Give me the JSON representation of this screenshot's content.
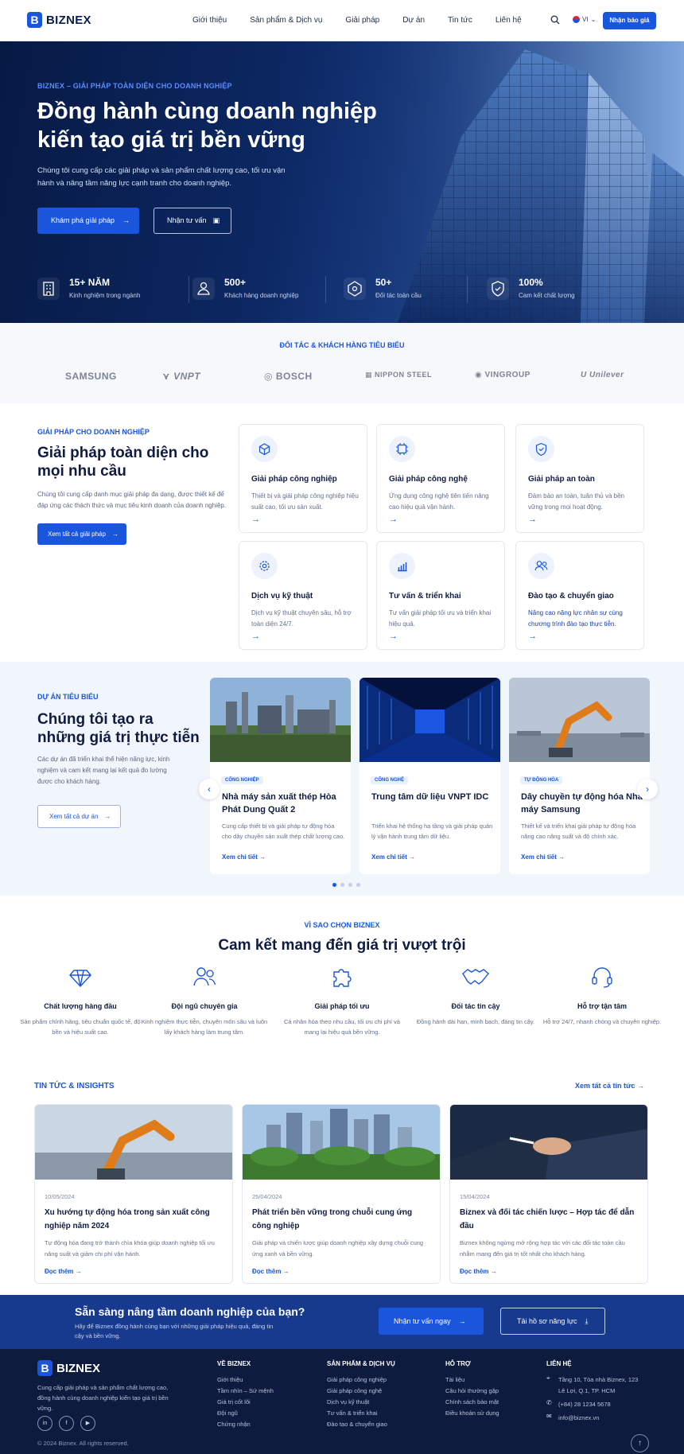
{
  "brand": {
    "name": "BIZNEX",
    "mark": "B",
    "primary": "#1a56db",
    "dark": "#0d1b3e"
  },
  "header": {
    "nav": [
      "Giới thiệu",
      "Sản phẩm & Dịch vụ",
      "Giải pháp",
      "Dự án",
      "Tin tức",
      "Liên hệ"
    ],
    "lang": "VI",
    "cta": "Nhận báo giá"
  },
  "hero": {
    "kicker": "BIZNEX – GIẢI PHÁP TOÀN DIỆN CHO DOANH NGHIỆP",
    "title": "Đồng hành cùng doanh nghiệp kiến tạo giá trị bền vững",
    "lead": "Chúng tôi cung cấp các giải pháp và sản phẩm chất lượng cao, tối ưu vận hành và nâng tầm năng lực cạnh tranh cho doanh nghiệp.",
    "primary_btn": "Khám phá giải pháp",
    "secondary_btn": "Nhận tư vấn",
    "stats": [
      {
        "num": "15+ NĂM",
        "label": "Kinh nghiệm trong ngành",
        "icon": "building-icon"
      },
      {
        "num": "500+",
        "label": "Khách hàng doanh nghiệp",
        "icon": "handshake-icon"
      },
      {
        "num": "50+",
        "label": "Đối tác toàn cầu",
        "icon": "network-icon"
      },
      {
        "num": "100%",
        "label": "Cam kết chất lượng",
        "icon": "badge-icon"
      }
    ]
  },
  "partners": {
    "heading": "ĐỐI TÁC & KHÁCH HÀNG TIÊU BIỂU",
    "logos": [
      "SAMSUNG",
      "VNPT",
      "BOSCH",
      "NIPPON STEEL",
      "VINGROUP",
      "Unilever"
    ]
  },
  "solutions": {
    "kicker": "GIẢI PHÁP CHO DOANH NGHIỆP",
    "title": "Giải pháp toàn diện cho mọi nhu cầu",
    "desc": "Chúng tôi cung cấp danh mục giải pháp đa dạng, được thiết kế để đáp ứng các thách thức và mục tiêu kinh doanh của doanh nghiệp.",
    "btn": "Xem tất cả giải pháp",
    "cards": [
      {
        "title": "Giải pháp công nghiệp",
        "desc": "Thiết bị và giải pháp công nghiệp hiệu suất cao, tối ưu sản xuất.",
        "icon": "cube-icon"
      },
      {
        "title": "Giải pháp công nghệ",
        "desc": "Ứng dụng công nghệ tiên tiến nâng cao hiệu quả vận hành.",
        "icon": "chip-icon"
      },
      {
        "title": "Giải pháp an toàn",
        "desc": "Đảm bảo an toàn, tuân thủ và bền vững trong mọi hoạt động.",
        "icon": "shield-icon"
      },
      {
        "title": "Dịch vụ kỹ thuật",
        "desc": "Dịch vụ kỹ thuật chuyên sâu, hỗ trợ toàn diện 24/7.",
        "icon": "gear-icon"
      },
      {
        "title": "Tư vấn & triển khai",
        "desc": "Tư vấn giải pháp tối ưu và triển khai hiệu quả.",
        "icon": "chart-icon"
      },
      {
        "title": "Đào tạo & chuyển giao",
        "desc": "Nâng cao năng lực nhân sự cùng chương trình đào tạo thực tiễn.",
        "icon": "users-icon"
      }
    ]
  },
  "projects": {
    "kicker": "DỰ ÁN TIÊU BIỂU",
    "title": "Chúng tôi tạo ra những giá trị thực tiễn",
    "desc": "Các dự án đã triển khai thể hiện năng lực, kinh nghiệm và cam kết mang lại kết quả đo lường được cho khách hàng.",
    "btn": "Xem tất cả dự án",
    "cards": [
      {
        "tag": "CÔNG NGHIỆP",
        "title": "Nhà máy sản xuất thép Hòa Phát Dung Quất 2",
        "desc": "Cung cấp thiết bị và giải pháp tự động hóa cho dây chuyền sản xuất thép chất lượng cao.",
        "link": "Xem chi tiết"
      },
      {
        "tag": "CÔNG NGHỆ",
        "title": "Trung tâm dữ liệu VNPT IDC",
        "desc": "Triển khai hệ thống hạ tầng và giải pháp quản lý vận hành trung tâm dữ liệu.",
        "link": "Xem chi tiết"
      },
      {
        "tag": "TỰ ĐỘNG HÓA",
        "title": "Dây chuyền tự động hóa Nhà máy Samsung",
        "desc": "Thiết kế và triển khai giải pháp tự động hóa nâng cao năng suất và độ chính xác.",
        "link": "Xem chi tiết"
      }
    ]
  },
  "why": {
    "kicker": "VÌ SAO CHỌN BIZNEX",
    "title": "Cam kết mang đến giá trị vượt trội",
    "items": [
      {
        "title": "Chất lượng hàng đầu",
        "desc": "Sản phẩm chính hãng, tiêu chuẩn quốc tế, độ bền và hiệu suất cao.",
        "icon": "diamond-icon"
      },
      {
        "title": "Đội ngũ chuyên gia",
        "desc": "Kinh nghiệm thực tiễn, chuyên môn sâu và luôn lấy khách hàng làm trung tâm.",
        "icon": "team-icon"
      },
      {
        "title": "Giải pháp tối ưu",
        "desc": "Cá nhân hóa theo nhu cầu, tối ưu chi phí và mang lại hiệu quả bền vững.",
        "icon": "puzzle-icon"
      },
      {
        "title": "Đối tác tin cậy",
        "desc": "Đồng hành dài hạn, minh bạch, đáng tin cậy.",
        "icon": "handshake-icon"
      },
      {
        "title": "Hỗ trợ tận tâm",
        "desc": "Hỗ trợ 24/7, nhanh chóng và chuyên nghiệp.",
        "icon": "headset-icon"
      }
    ]
  },
  "news": {
    "kicker": "TIN TỨC & INSIGHTS",
    "all": "Xem tất cả tin tức",
    "items": [
      {
        "date": "10/05/2024",
        "title": "Xu hướng tự động hóa trong sản xuất công nghiệp năm 2024",
        "desc": "Tự động hóa đang trở thành chìa khóa giúp doanh nghiệp tối ưu năng suất và giảm chi phí vận hành.",
        "link": "Đọc thêm"
      },
      {
        "date": "25/04/2024",
        "title": "Phát triển bền vững trong chuỗi cung ứng công nghiệp",
        "desc": "Giải pháp và chiến lược giúp doanh nghiệp xây dựng chuỗi cung ứng xanh và bền vững.",
        "link": "Đọc thêm"
      },
      {
        "date": "15/04/2024",
        "title": "Biznex và đối tác chiến lược – Hợp tác để dẫn đầu",
        "desc": "Biznex không ngừng mở rộng hợp tác với các đối tác toàn cầu nhằm mang đến giá trị tốt nhất cho khách hàng.",
        "link": "Đọc thêm"
      }
    ]
  },
  "cta": {
    "title": "Sẵn sàng nâng tầm doanh nghiệp của bạn?",
    "desc": "Hãy để Biznex đồng hành cùng bạn với những giải pháp hiệu quả, đáng tin cậy và bền vững.",
    "btn1": "Nhận tư vấn ngay",
    "btn2": "Tải hồ sơ năng lực"
  },
  "footer": {
    "about": "Cung cấp giải pháp và sản phẩm chất lượng cao, đồng hành cùng doanh nghiệp kiến tạo giá trị bền vững.",
    "social": [
      "in",
      "f",
      "▶"
    ],
    "cols": [
      {
        "heading": "VỀ BIZNEX",
        "items": [
          "Giới thiệu",
          "Tầm nhìn – Sứ mệnh",
          "Giá trị cốt lõi",
          "Đội ngũ",
          "Chứng nhận"
        ]
      },
      {
        "heading": "SẢN PHẨM & DỊCH VỤ",
        "items": [
          "Giải pháp công nghiệp",
          "Giải pháp công nghệ",
          "Dịch vụ kỹ thuật",
          "Tư vấn & triển khai",
          "Đào tạo & chuyển giao"
        ]
      },
      {
        "heading": "HỖ TRỢ",
        "items": [
          "Tài liệu",
          "Câu hỏi thường gặp",
          "Chính sách bảo mật",
          "Điều khoản sử dụng"
        ]
      }
    ],
    "contact_heading": "LIÊN HỆ",
    "address": "Tầng 10, Tòa nhà Biznex, 123 Lê Lợi, Q.1, TP. HCM",
    "phone": "(+84) 28 1234 5678",
    "email": "info@biznex.vn",
    "copyright": "© 2024 Biznex. All rights reserved."
  }
}
